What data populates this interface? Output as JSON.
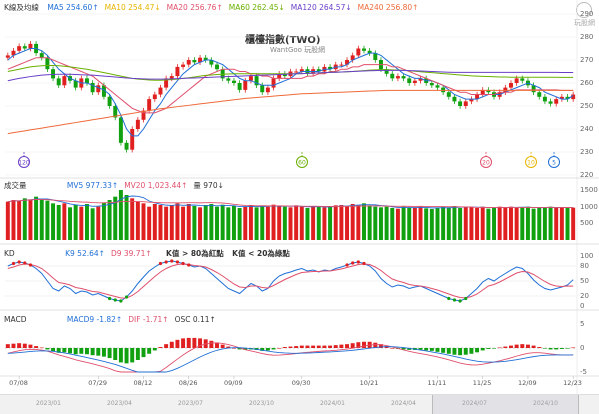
{
  "title": "櫃檯指數(TWO)",
  "subtitle": "WantGoo 玩股網",
  "logo_text": "玩股網",
  "price_pane": {
    "label": "K線及均線",
    "ma": [
      {
        "name": "MA5",
        "value": "254.60",
        "arrow": "↑",
        "color": "#1f6fd6"
      },
      {
        "name": "MA10",
        "value": "254.47",
        "arrow": "↓",
        "color": "#e8b400"
      },
      {
        "name": "MA20",
        "value": "256.76",
        "arrow": "↑",
        "color": "#e0506c"
      },
      {
        "name": "MA60",
        "value": "262.45",
        "arrow": "↓",
        "color": "#6ab000"
      },
      {
        "name": "MA120",
        "value": "264.57",
        "arrow": "↓",
        "color": "#6a3fc8"
      },
      {
        "name": "MA240",
        "value": "256.80",
        "arrow": "↑",
        "color": "#ee6a3a"
      }
    ],
    "yticks": [
      "290",
      "280",
      "270",
      "260",
      "250",
      "240",
      "230",
      "220"
    ],
    "markers": [
      {
        "text": "120",
        "color": "#6a3fc8"
      },
      {
        "text": "60",
        "color": "#6ab000"
      },
      {
        "text": "20",
        "color": "#e0506c"
      },
      {
        "text": "10",
        "color": "#e8b400"
      },
      {
        "text": "5",
        "color": "#1f6fd6"
      }
    ]
  },
  "volume_pane": {
    "label": "成交量",
    "items": [
      {
        "name": "MV5",
        "value": "977.33",
        "arrow": "↑",
        "color": "#1f6fd6"
      },
      {
        "name": "MV20",
        "value": "1,023.44",
        "arrow": "↑",
        "color": "#e0506c"
      },
      {
        "name": "量",
        "value": "970",
        "arrow": "↓",
        "color": "#333333"
      }
    ],
    "yticks": [
      "1500",
      "1000",
      "500"
    ]
  },
  "kd_pane": {
    "label": "KD",
    "items": [
      {
        "name": "K9",
        "value": "52.64",
        "arrow": "↑",
        "color": "#1f6fd6"
      },
      {
        "name": "D9",
        "value": "39.71",
        "arrow": "↑",
        "color": "#e0506c"
      }
    ],
    "note1": "K值 > 80為紅點",
    "note2": "K值 < 20為綠點",
    "yticks": [
      "100",
      "80",
      "50",
      "20",
      "0"
    ]
  },
  "macd_pane": {
    "label": "MACD",
    "items": [
      {
        "name": "MACD9",
        "value": "-1.82",
        "arrow": "↑",
        "color": "#1f6fd6"
      },
      {
        "name": "DIF",
        "value": "-1.71",
        "arrow": "↑",
        "color": "#e0506c"
      },
      {
        "name": "OSC",
        "value": "0.11",
        "arrow": "↑",
        "color": "#333333"
      }
    ],
    "yticks": [
      "5",
      "0",
      "-5"
    ]
  },
  "x_dates": [
    "07/08",
    "07/29",
    "08/12",
    "08/26",
    "09/09",
    "09/30",
    "10/21",
    "11/11",
    "11/25",
    "12/09",
    "12/23"
  ],
  "year_labels": [
    "2023/01",
    "2023/04",
    "2023/07",
    "2023/10",
    "2024/01",
    "2024/04",
    "2024/07",
    "2024/10"
  ],
  "chart_data": {
    "type": "candlestick",
    "title": "櫃檯指數(TWO)",
    "ylim": [
      220,
      290
    ],
    "x_ticks": [
      "07/08",
      "07/29",
      "08/12",
      "08/26",
      "09/09",
      "09/30",
      "10/21",
      "11/11",
      "11/25",
      "12/09",
      "12/23"
    ],
    "close": [
      272,
      274,
      276,
      275,
      277,
      273,
      271,
      266,
      262,
      259,
      263,
      261,
      258,
      262,
      260,
      256,
      259,
      254,
      250,
      245,
      234,
      231,
      240,
      244,
      248,
      253,
      255,
      258,
      262,
      263,
      267,
      268,
      270,
      269,
      271,
      270,
      268,
      266,
      262,
      261,
      260,
      257,
      261,
      263,
      259,
      256,
      258,
      262,
      264,
      263,
      265,
      265,
      266,
      264,
      266,
      265,
      267,
      266,
      268,
      268,
      270,
      272,
      275,
      274,
      273,
      270,
      266,
      264,
      262,
      263,
      262,
      260,
      261,
      262,
      260,
      259,
      258,
      256,
      254,
      252,
      250,
      252,
      253,
      255,
      257,
      256,
      254,
      256,
      258,
      260,
      262,
      261,
      259,
      256,
      254,
      252,
      251,
      253,
      254,
      253,
      255
    ],
    "ma": {
      "MA5": [
        270,
        272,
        273,
        274,
        275,
        275,
        274,
        272,
        269,
        266,
        264,
        262,
        261,
        260,
        260,
        259,
        258,
        257,
        255,
        251,
        246,
        240,
        237,
        237,
        240,
        244,
        248,
        251,
        255,
        258,
        261,
        264,
        266,
        268,
        269,
        270,
        270,
        269,
        268,
        266,
        264,
        262,
        261,
        261,
        260,
        259,
        259,
        259,
        260,
        261,
        262,
        264,
        265,
        265,
        265,
        265,
        266,
        266,
        267,
        267,
        268,
        270,
        271,
        272,
        273,
        273,
        272,
        270,
        268,
        266,
        264,
        263,
        262,
        262,
        261,
        261,
        260,
        259,
        257,
        255,
        254,
        253,
        253,
        253,
        254,
        255,
        255,
        255,
        256,
        257,
        258,
        259,
        260,
        259,
        258,
        256,
        255,
        254,
        253,
        253,
        254.6
      ],
      "MA20": [
        266,
        267,
        268,
        269,
        270,
        271,
        271,
        271,
        270,
        269,
        268,
        267,
        266,
        265,
        264,
        263,
        261,
        259,
        257,
        255,
        253,
        251,
        249,
        248,
        247,
        247,
        247,
        248,
        249,
        251,
        253,
        255,
        257,
        259,
        261,
        263,
        264,
        265,
        266,
        266,
        266,
        265,
        265,
        264,
        264,
        263,
        263,
        262,
        262,
        262,
        262,
        262,
        262,
        263,
        263,
        264,
        264,
        265,
        265,
        266,
        266,
        267,
        267,
        268,
        268,
        268,
        268,
        268,
        267,
        267,
        266,
        265,
        264,
        263,
        262,
        261,
        260,
        259,
        258,
        257,
        256,
        256,
        255,
        255,
        255,
        255,
        255,
        256,
        256,
        256,
        257,
        257,
        257,
        257,
        257,
        257,
        257,
        257,
        256.8,
        256.8,
        256.76
      ],
      "MA60": [
        265,
        265.5,
        266,
        266.5,
        267,
        267.3,
        267.5,
        267.6,
        267.6,
        267.5,
        267.3,
        267,
        266.7,
        266.3,
        266,
        265.5,
        265,
        264.5,
        264,
        263.5,
        263,
        262.5,
        262,
        261.7,
        261.5,
        261.3,
        261.2,
        261.2,
        261.3,
        261.5,
        261.7,
        262,
        262.3,
        262.6,
        263,
        263.3,
        263.5,
        263.7,
        263.8,
        263.9,
        264,
        264,
        264,
        264,
        264,
        264,
        264,
        264,
        264,
        264,
        264,
        264,
        264.1,
        264.2,
        264.3,
        264.4,
        264.5,
        264.6,
        264.7,
        264.8,
        264.9,
        265,
        265.2,
        265.4,
        265.6,
        265.7,
        265.8,
        265.8,
        265.7,
        265.6,
        265.5,
        265.3,
        265.1,
        264.9,
        264.7,
        264.5,
        264.3,
        264.1,
        263.9,
        263.7,
        263.5,
        263.3,
        263.1,
        263,
        262.9,
        262.8,
        262.7,
        262.6,
        262.6,
        262.5,
        262.5,
        262.5,
        262.5,
        262.5,
        262.5,
        262.5,
        262.5,
        262.5,
        262.45,
        262.45,
        262.45
      ],
      "MA120": [
        261,
        261.5,
        262,
        262.4,
        262.8,
        263.1,
        263.4,
        263.6,
        263.7,
        263.8,
        263.8,
        263.8,
        263.7,
        263.6,
        263.5,
        263.4,
        263.2,
        263,
        262.8,
        262.6,
        262.4,
        262.2,
        262,
        261.9,
        261.8,
        261.7,
        261.7,
        261.7,
        261.7,
        261.8,
        261.9,
        262,
        262.1,
        262.2,
        262.3,
        262.4,
        262.5,
        262.6,
        262.7,
        262.8,
        262.9,
        263,
        263.1,
        263.2,
        263.3,
        263.4,
        263.5,
        263.6,
        263.7,
        263.8,
        263.9,
        264,
        264.1,
        264.2,
        264.3,
        264.4,
        264.5,
        264.6,
        264.7,
        264.8,
        264.9,
        265,
        265.1,
        265.2,
        265.3,
        265.4,
        265.5,
        265.5,
        265.5,
        265.5,
        265.5,
        265.4,
        265.3,
        265.2,
        265.1,
        265,
        264.9,
        264.8,
        264.7,
        264.6,
        264.6,
        264.6,
        264.6,
        264.6,
        264.6,
        264.6,
        264.6,
        264.6,
        264.6,
        264.6,
        264.6,
        264.6,
        264.6,
        264.6,
        264.6,
        264.6,
        264.6,
        264.6,
        264.57,
        264.57,
        264.57
      ],
      "MA240": [
        238,
        238.4,
        238.8,
        239.2,
        239.6,
        240,
        240.4,
        240.8,
        241.2,
        241.6,
        242,
        242.4,
        242.8,
        243.2,
        243.6,
        244,
        244.4,
        244.8,
        245.2,
        245.6,
        246,
        246.4,
        246.8,
        247.2,
        247.6,
        248,
        248.4,
        248.8,
        249.1,
        249.4,
        249.7,
        250,
        250.3,
        250.6,
        250.9,
        251.2,
        251.5,
        251.8,
        252.1,
        252.4,
        252.7,
        253,
        253.3,
        253.5,
        253.7,
        253.9,
        254.1,
        254.3,
        254.5,
        254.7,
        254.9,
        255.1,
        255.3,
        255.4,
        255.5,
        255.6,
        255.7,
        255.8,
        255.9,
        256,
        256.1,
        256.2,
        256.3,
        256.4,
        256.5,
        256.6,
        256.7,
        256.8,
        256.8,
        256.8,
        256.8,
        256.8,
        256.8,
        256.8,
        256.8,
        256.8,
        256.8,
        256.8,
        256.8,
        256.8,
        256.8,
        256.8,
        256.8,
        256.8,
        256.8,
        256.8,
        256.8,
        256.8,
        256.8,
        256.8,
        256.8,
        256.8,
        256.8,
        256.8,
        256.8,
        256.8,
        256.8,
        256.8,
        256.8,
        256.8,
        256.8
      ]
    },
    "volume_ylim": [
      0,
      1500
    ],
    "volume": [
      1150,
      1200,
      1180,
      1250,
      1220,
      1300,
      1200,
      1180,
      1100,
      1050,
      1100,
      980,
      1050,
      1000,
      1080,
      950,
      1000,
      1120,
      1200,
      1300,
      1500,
      1350,
      1250,
      1150,
      1100,
      1000,
      1080,
      1050,
      1000,
      1050,
      1100,
      1000,
      1080,
      1020,
      980,
      1050,
      1080,
      1000,
      1060,
      980,
      1020,
      960,
      1000,
      1050,
      980,
      1020,
      1000,
      1060,
      1020,
      1000,
      980,
      1040,
      1000,
      960,
      1000,
      1020,
      980,
      1000,
      1040,
      1050,
      1020,
      1080,
      1050,
      1100,
      1040,
      1000,
      980,
      1000,
      960,
      940,
      1000,
      960,
      980,
      1000,
      950,
      930,
      960,
      1000,
      980,
      1020,
      960,
      1000,
      980,
      960,
      1000,
      940,
      960,
      1000,
      980,
      1000,
      960,
      980,
      1000,
      940,
      960,
      980,
      1000,
      960,
      980,
      960,
      970
    ],
    "k": [
      80,
      85,
      88,
      86,
      82,
      75,
      65,
      50,
      35,
      30,
      40,
      35,
      25,
      30,
      28,
      22,
      25,
      20,
      15,
      12,
      10,
      18,
      30,
      45,
      58,
      70,
      78,
      85,
      88,
      90,
      88,
      85,
      82,
      78,
      80,
      75,
      65,
      55,
      45,
      35,
      30,
      25,
      35,
      45,
      40,
      30,
      35,
      50,
      60,
      65,
      68,
      72,
      75,
      70,
      72,
      68,
      72,
      70,
      75,
      78,
      82,
      86,
      88,
      85,
      80,
      70,
      55,
      45,
      38,
      42,
      40,
      35,
      38,
      40,
      35,
      30,
      25,
      20,
      15,
      12,
      10,
      15,
      25,
      35,
      48,
      55,
      50,
      58,
      65,
      72,
      78,
      75,
      65,
      52,
      42,
      35,
      32,
      35,
      38,
      42,
      52.64
    ],
    "d": [
      75,
      78,
      82,
      84,
      83,
      80,
      75,
      66,
      56,
      47,
      45,
      42,
      37,
      35,
      32,
      29,
      28,
      25,
      22,
      19,
      16,
      16,
      21,
      29,
      39,
      49,
      59,
      68,
      75,
      80,
      83,
      84,
      83,
      81,
      80,
      78,
      73,
      67,
      60,
      52,
      44,
      38,
      37,
      40,
      40,
      37,
      36,
      41,
      47,
      53,
      58,
      63,
      67,
      68,
      69,
      69,
      70,
      70,
      72,
      74,
      77,
      80,
      83,
      84,
      83,
      78,
      71,
      62,
      54,
      50,
      47,
      43,
      41,
      40,
      38,
      35,
      32,
      28,
      24,
      20,
      17,
      16,
      19,
      24,
      32,
      40,
      43,
      48,
      54,
      60,
      66,
      69,
      68,
      63,
      56,
      49,
      43,
      40,
      39,
      40,
      39.71
    ],
    "osc": [
      0.8,
      0.9,
      1.0,
      0.9,
      0.7,
      0.4,
      0.1,
      -0.3,
      -0.7,
      -1.0,
      -0.9,
      -1.1,
      -1.3,
      -1.2,
      -1.3,
      -1.5,
      -1.6,
      -1.8,
      -2.1,
      -2.5,
      -3.0,
      -3.2,
      -3.0,
      -2.5,
      -1.9,
      -1.2,
      -0.5,
      0.2,
      0.8,
      1.3,
      1.7,
      2.0,
      2.1,
      2.1,
      2.0,
      1.8,
      1.5,
      1.1,
      0.7,
      0.3,
      0.0,
      -0.3,
      -0.4,
      -0.3,
      -0.4,
      -0.6,
      -0.5,
      -0.3,
      0.0,
      0.2,
      0.3,
      0.4,
      0.5,
      0.5,
      0.5,
      0.5,
      0.5,
      0.5,
      0.6,
      0.7,
      0.8,
      1.0,
      1.2,
      1.3,
      1.3,
      1.1,
      0.8,
      0.4,
      0.0,
      -0.2,
      -0.3,
      -0.4,
      -0.4,
      -0.4,
      -0.5,
      -0.6,
      -0.8,
      -1.0,
      -1.2,
      -1.4,
      -1.5,
      -1.4,
      -1.2,
      -0.9,
      -0.5,
      -0.2,
      -0.1,
      0.1,
      0.3,
      0.5,
      0.7,
      0.8,
      0.7,
      0.5,
      0.2,
      -0.1,
      -0.3,
      -0.3,
      -0.2,
      -0.1,
      0.11
    ],
    "macd_ylim": [
      -5,
      5
    ]
  }
}
